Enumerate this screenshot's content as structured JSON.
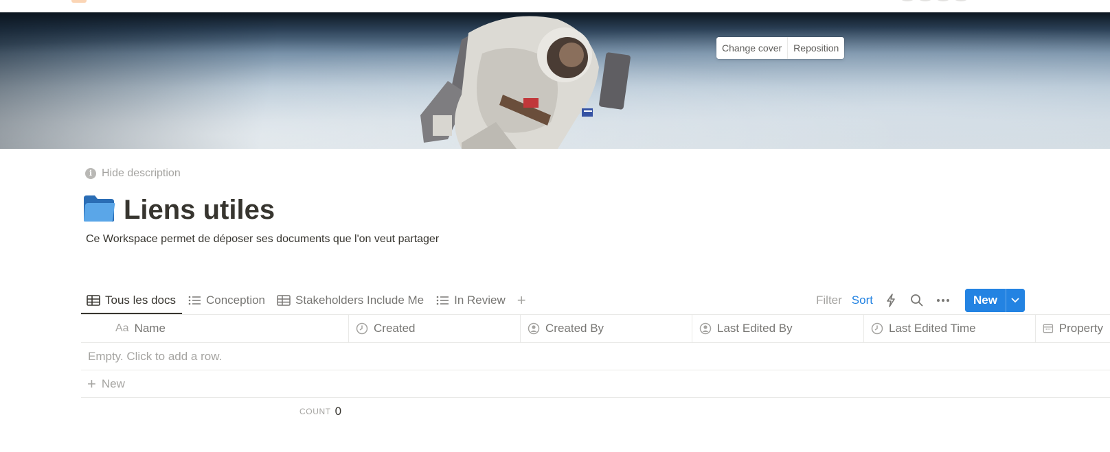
{
  "cover": {
    "change_cover_label": "Change cover",
    "reposition_label": "Reposition"
  },
  "header": {
    "hide_description_label": "Hide description",
    "page_icon": "blue-folder-icon",
    "title": "Liens utiles",
    "description": "Ce Workspace permet de déposer ses documents que l'on veut partager"
  },
  "views": {
    "tabs": [
      {
        "label": "Tous les docs",
        "icon": "table-icon",
        "active": true
      },
      {
        "label": "Conception",
        "icon": "list-icon",
        "active": false
      },
      {
        "label": "Stakeholders Include Me",
        "icon": "table-icon",
        "active": false
      },
      {
        "label": "In Review",
        "icon": "list-icon",
        "active": false
      }
    ],
    "add_view_icon": "plus-icon"
  },
  "toolbar": {
    "filter_label": "Filter",
    "sort_label": "Sort",
    "automation_icon": "lightning-icon",
    "search_icon": "search-icon",
    "more_icon": "ellipsis-icon",
    "new_label": "New",
    "new_dropdown_icon": "chevron-down-icon"
  },
  "table": {
    "columns": [
      {
        "label": "Name",
        "prefix": "Aa",
        "icon": "title-icon"
      },
      {
        "label": "Created",
        "icon": "clock-icon"
      },
      {
        "label": "Created By",
        "icon": "person-icon"
      },
      {
        "label": "Last Edited By",
        "icon": "person-icon"
      },
      {
        "label": "Last Edited Time",
        "icon": "clock-icon"
      },
      {
        "label": "Property",
        "icon": "calendar-icon"
      }
    ],
    "empty_text": "Empty. Click to add a row.",
    "new_row_label": "New",
    "count_label": "COUNT",
    "count_value": "0"
  },
  "colors": {
    "accent": "#2383e2",
    "text": "#37352f",
    "muted": "#a5a4a1"
  }
}
